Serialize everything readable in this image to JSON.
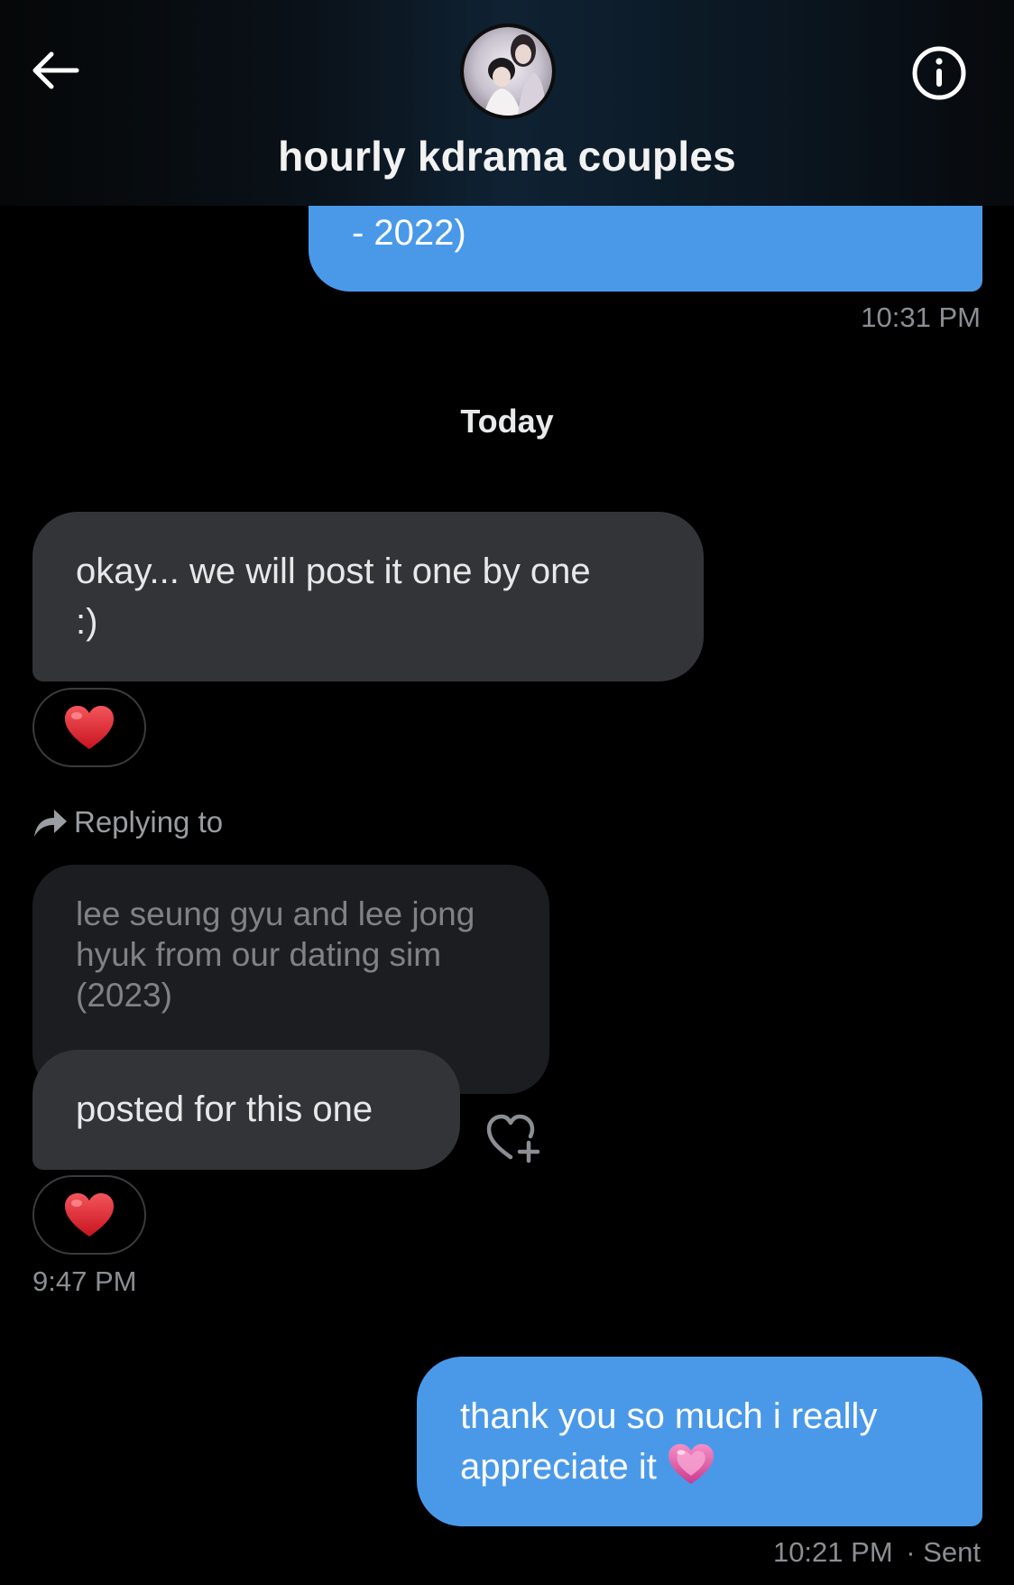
{
  "header": {
    "title": "hourly kdrama couples",
    "back_icon": "arrow-left-icon",
    "info_icon": "info-icon"
  },
  "messages": {
    "out_1": {
      "text": "- 2022)",
      "time": "10:31 PM"
    },
    "day_separator": "Today",
    "in_1": {
      "text": "okay... we will post it one by one\n:)",
      "reaction": "heart"
    },
    "reply": {
      "label": "Replying to",
      "quoted_text": "lee seung gyu and lee jong\nhyuk from our dating sim\n(2023)",
      "text": "posted for this one",
      "reaction": "heart",
      "time": "9:47 PM"
    },
    "out_2": {
      "text": "thank you so much i really\nappreciate it",
      "emoji": "pink-heart",
      "time": "10:21 PM",
      "status": "· Sent"
    }
  },
  "colors": {
    "outgoing_bubble": "#4a99e9",
    "incoming_bubble": "#333438",
    "quoted_bubble": "#1c1d20",
    "background": "#000000",
    "heart_red": "#e0242f",
    "heart_pink": "#e35aa8"
  }
}
